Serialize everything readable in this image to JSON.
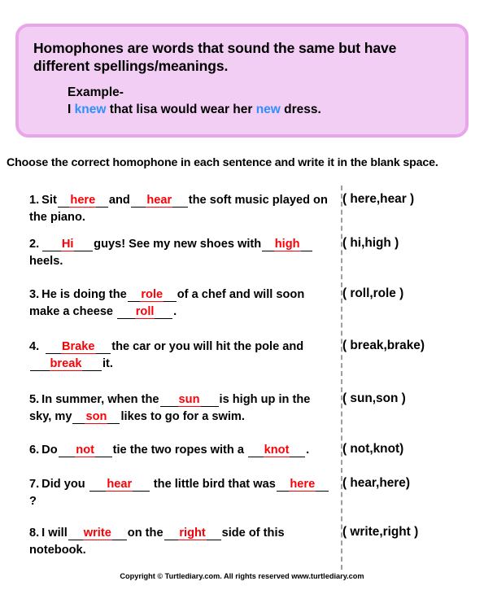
{
  "definition": {
    "title": "Homophones are words that sound the same but have different spellings/meanings.",
    "example_label": "Example-",
    "example_pre": "I ",
    "example_word1": "knew",
    "example_mid": " that lisa would wear her ",
    "example_word2": "new",
    "example_post": " dress.",
    "blue_color": "#2f90ff",
    "box_fill": "#f2cdf4",
    "box_border": "#e8a6e8"
  },
  "instruction": "Choose the correct homophone in each sentence and write it in the blank space.",
  "answer_color": "#fb0007",
  "questions": [
    {
      "number": "1.",
      "seg1": "Sit",
      "answer1": "here",
      "seg2": "and",
      "answer2": "hear",
      "seg3": "the soft music played on the piano.",
      "options": "( here,hear )"
    },
    {
      "number": "2.",
      "seg1": "",
      "answer1": "Hi",
      "seg2": "guys! See my new shoes with",
      "answer2": "high",
      "seg3": "heels.",
      "options": "( hi,high )"
    },
    {
      "number": "3.",
      "seg1": "He is doing the",
      "answer1": "role",
      "seg2": "of a chef and will soon make a cheese ",
      "answer2": "roll",
      "seg3": ".",
      "options": "( roll,role )"
    },
    {
      "number": "4.",
      "seg1": " ",
      "answer1": "Brake",
      "seg2": "the car or you will hit the pole and ",
      "answer2": "break",
      "seg3": "it.",
      "options": "( break,brake)"
    },
    {
      "number": "5.",
      "seg1": "In summer, when the",
      "answer1": "sun",
      "seg2": "is high up in the sky, my",
      "answer2": "son",
      "seg3": "likes to go for a swim.",
      "options": "( sun,son )"
    },
    {
      "number": "6.",
      "seg1": "Do",
      "answer1": "not",
      "seg2": "tie the two ropes with a ",
      "answer2": "knot",
      "seg3": ".",
      "options": "( not,knot)"
    },
    {
      "number": "7.",
      "seg1": "Did you ",
      "answer1": "hear",
      "seg2": " the little bird that was",
      "answer2": "here",
      "seg3": "?",
      "options": "( hear,here)"
    },
    {
      "number": "8.",
      "seg1": "I will",
      "answer1": "write",
      "seg2": "on the",
      "answer2": "right",
      "seg3": "side of this notebook.",
      "options": "( write,right )"
    }
  ],
  "footer": "Copyright © Turtlediary.com. All rights reserved  www.turtlediary.com"
}
